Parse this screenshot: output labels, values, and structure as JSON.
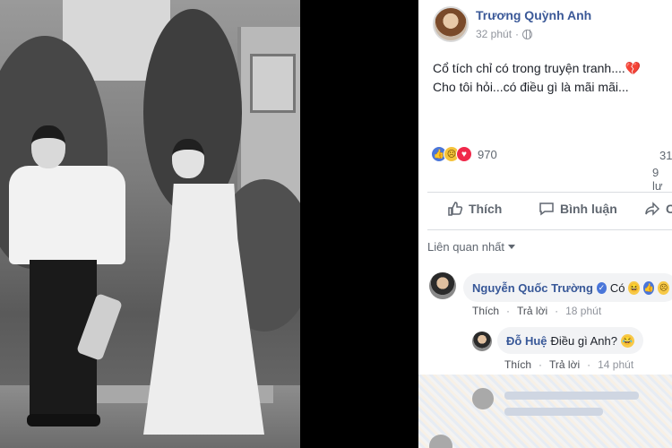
{
  "post": {
    "author": "Trương Quỳnh Anh",
    "time": "32 phút",
    "text_line1": "Cổ tích chỉ có trong truyện tranh....",
    "text_line2": "Cho tôi hỏi...có điều gì là mãi mãi...",
    "reaction_count": "970",
    "right_count1": "31",
    "right_count2": "9 lư"
  },
  "actions": {
    "like": "Thích",
    "comment": "Bình luận",
    "share": "C"
  },
  "filter": {
    "label": "Liên quan nhất"
  },
  "comments": [
    {
      "name": "Nguyễn Quốc Trường",
      "text": "Có",
      "like": "Thích",
      "reply": "Trả lời",
      "time": "18 phút"
    },
    {
      "name": "Đỗ Huệ",
      "text": "Điều gì Anh?",
      "like": "Thích",
      "reply": "Trả lời",
      "time": "14 phút"
    }
  ],
  "colors": {
    "link": "#385898",
    "like_blue": "#4a76d9",
    "love_red": "#f0284a",
    "muted": "#90949c"
  }
}
